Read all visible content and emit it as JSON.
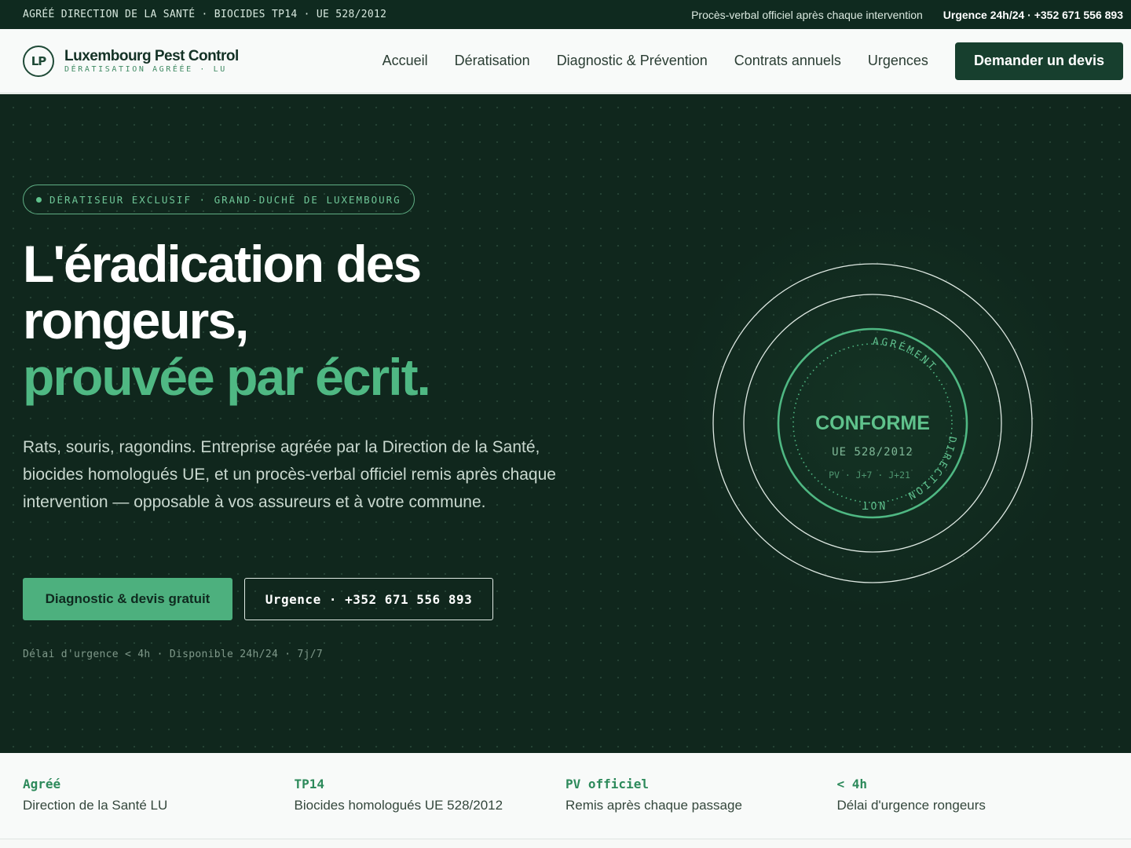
{
  "topbar": {
    "left": "AGRÉÉ DIRECTION DE LA SANTÉ · BIOCIDES TP14 · UE 528/2012",
    "report": "Procès-verbal officiel après chaque intervention",
    "urgent": "Urgence 24h/24 · +352 671 556 893"
  },
  "header": {
    "logo_mark": "LP",
    "brand_name": "Luxembourg Pest Control",
    "brand_tag": "DÉRATISATION AGRÉÉE · LU",
    "nav": [
      "Accueil",
      "Dératisation",
      "Diagnostic & Prévention",
      "Contrats annuels",
      "Urgences"
    ],
    "cta": "Demander un devis"
  },
  "hero": {
    "pill": "DÉRATISEUR EXCLUSIF · GRAND-DUCHÉ DE LUXEMBOURG",
    "title_line1": "L'éradication des rongeurs,",
    "title_accent": "prouvée par écrit.",
    "description": "Rats, souris, ragondins. Entreprise agréée par la Direction de la Santé, biocides homologués UE, et un procès-verbal officiel remis après chaque intervention — opposable à vos assureurs et à votre commune.",
    "primary_button": "Diagnostic & devis gratuit",
    "secondary_button": "Urgence · +352 671 556 893",
    "note": "Délai d'urgence < 4h · Disponible 24h/24 · 7j/7"
  },
  "seal": {
    "main": "CONFORME",
    "reg": "UE 528/2012",
    "steps": "PV · J+7 · J+21",
    "arc_top": "AGRÉMENT",
    "arc_right": "DIRECTION"
  },
  "features": [
    {
      "key": "Agréé",
      "value": "Direction de la Santé LU"
    },
    {
      "key": "TP14",
      "value": "Biocides homologués UE 528/2012"
    },
    {
      "key": "PV officiel",
      "value": "Remis après chaque passage"
    },
    {
      "key": "< 4h",
      "value": "Délai d'urgence rongeurs"
    }
  ],
  "colors": {
    "dark_green": "#10271d",
    "accent_green": "#4fb883",
    "button_dark": "#173f2e"
  }
}
